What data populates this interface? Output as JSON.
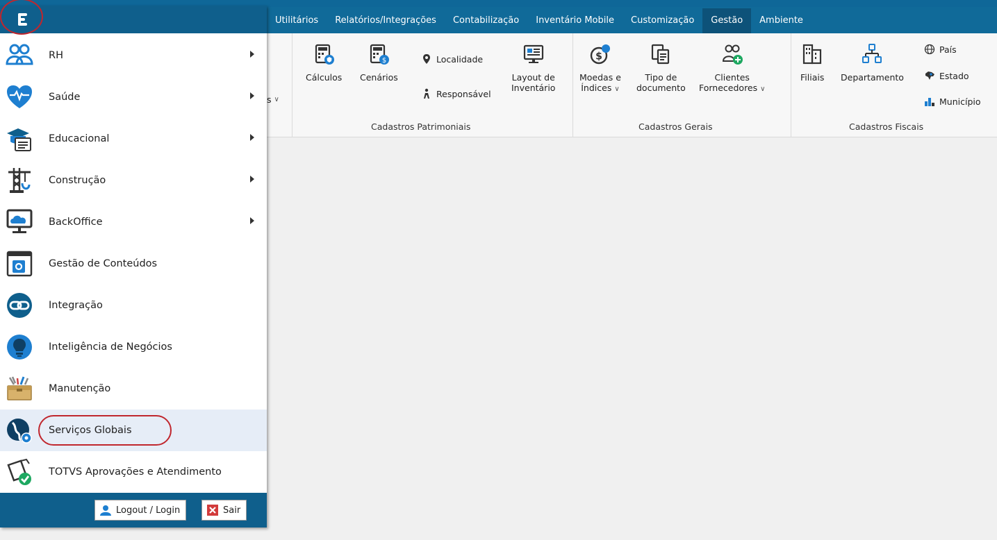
{
  "ribbon_tabs": [
    "Utilitários",
    "Relatórios/Integrações",
    "Contabilização",
    "Inventário Mobile",
    "Customização",
    "Gestão",
    "Ambiente"
  ],
  "active_tab": "Gestão",
  "ribbon": {
    "partial_label": "s",
    "patrimoniais": {
      "group_label": "Cadastros Patrimoniais",
      "calculos": "Cálculos",
      "cenarios": "Cenários",
      "localidade": "Localidade",
      "responsavel": "Responsável",
      "layout_line1": "Layout de",
      "layout_line2": "Inventário"
    },
    "gerais": {
      "group_label": "Cadastros Gerais",
      "moedas_line1": "Moedas e",
      "moedas_line2": "Índices",
      "tipo_line1": "Tipo de",
      "tipo_line2": "documento",
      "clientes_line1": "Clientes",
      "clientes_line2": "Fornecedores"
    },
    "fiscais": {
      "group_label": "Cadastros Fiscais",
      "filiais": "Filiais",
      "departamento": "Departamento",
      "pais": "País",
      "estado": "Estado",
      "municipio": "Município"
    }
  },
  "menu": {
    "items": [
      {
        "label": "RH",
        "icon": "people-icon",
        "submenu": true
      },
      {
        "label": "Saúde",
        "icon": "heart-pulse-icon",
        "submenu": true
      },
      {
        "label": "Educacional",
        "icon": "graduation-icon",
        "submenu": true
      },
      {
        "label": "Construção",
        "icon": "crane-icon",
        "submenu": true
      },
      {
        "label": "BackOffice",
        "icon": "monitor-cloud-icon",
        "submenu": true
      },
      {
        "label": "Gestão de Conteúdos",
        "icon": "content-gear-icon",
        "submenu": false
      },
      {
        "label": "Integração",
        "icon": "link-icon",
        "submenu": false
      },
      {
        "label": "Inteligência de Negócios",
        "icon": "lightbulb-icon",
        "submenu": false
      },
      {
        "label": "Manutenção",
        "icon": "toolbox-icon",
        "submenu": false
      },
      {
        "label": "Serviços Globais",
        "icon": "globe-gear-icon",
        "submenu": false,
        "highlighted": true
      },
      {
        "label": "TOTVS Aprovações e Atendimento",
        "icon": "approval-check-icon",
        "submenu": false
      }
    ],
    "logout_label": "Logout / Login",
    "exit_label": "Sair"
  },
  "colors": {
    "ribbon_bar": "#106a99",
    "menu_bar": "#0f5f8c",
    "active_tab": "#0d5279",
    "annotation_circle": "#c0262d",
    "highlight": "#e6edf7",
    "icon_blue": "#1e7fd0"
  }
}
